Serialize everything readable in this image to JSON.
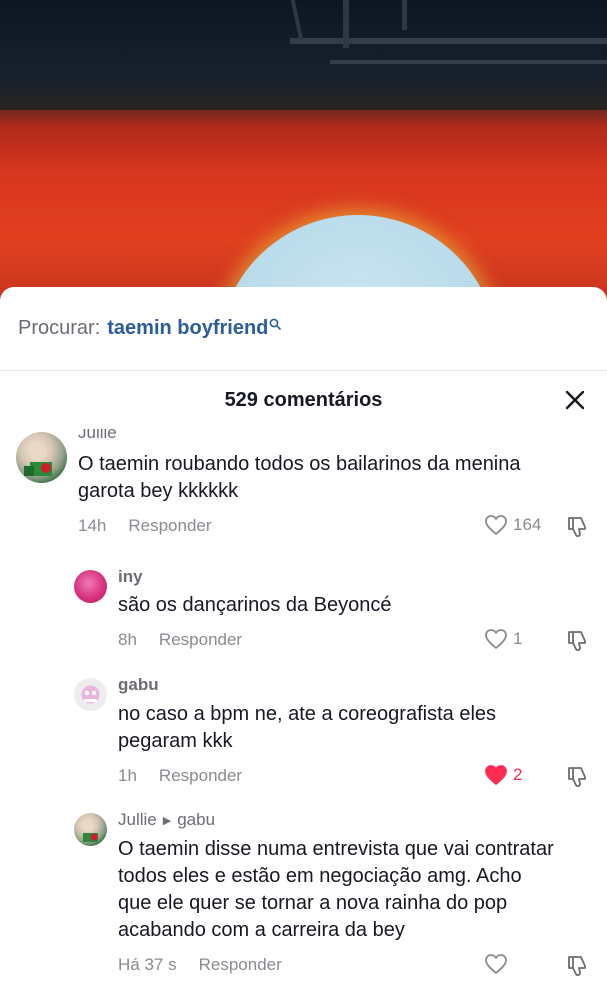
{
  "search": {
    "label": "Procurar:",
    "term": "taemin boyfriend"
  },
  "header": {
    "title": "529 comentários"
  },
  "comments": [
    {
      "user": "Jullie",
      "text_line1": "O taemin roubando todos os bailarinos da menina",
      "text_line2": "garota bey kkkkkk",
      "time": "14h",
      "reply": "Responder",
      "likes": "164",
      "liked": false
    },
    {
      "user": "iny",
      "text_line1": "são os dançarinos da Beyoncé",
      "time": "8h",
      "reply": "Responder",
      "likes": "1",
      "liked": false
    },
    {
      "user": "gabu",
      "text_line1": "no caso a bpm ne, ate a coreografista eles",
      "text_line2": "pegaram kkk",
      "time": "1h",
      "reply": "Responder",
      "likes": "2",
      "liked": true
    },
    {
      "user": "Jullie",
      "reply_to": "gabu",
      "text_line1": "O taemin disse numa entrevista que vai contratar",
      "text_line2": "todos eles e estão em negociação amg. Acho",
      "text_line3": "que ele quer se tornar a nova rainha do pop",
      "text_line4": "acabando com a carreira da bey",
      "time": "Há 37 s",
      "reply": "Responder",
      "liked": false
    }
  ],
  "colors": {
    "accent": "#fe2c55",
    "search_term": "#2b5d9c"
  }
}
